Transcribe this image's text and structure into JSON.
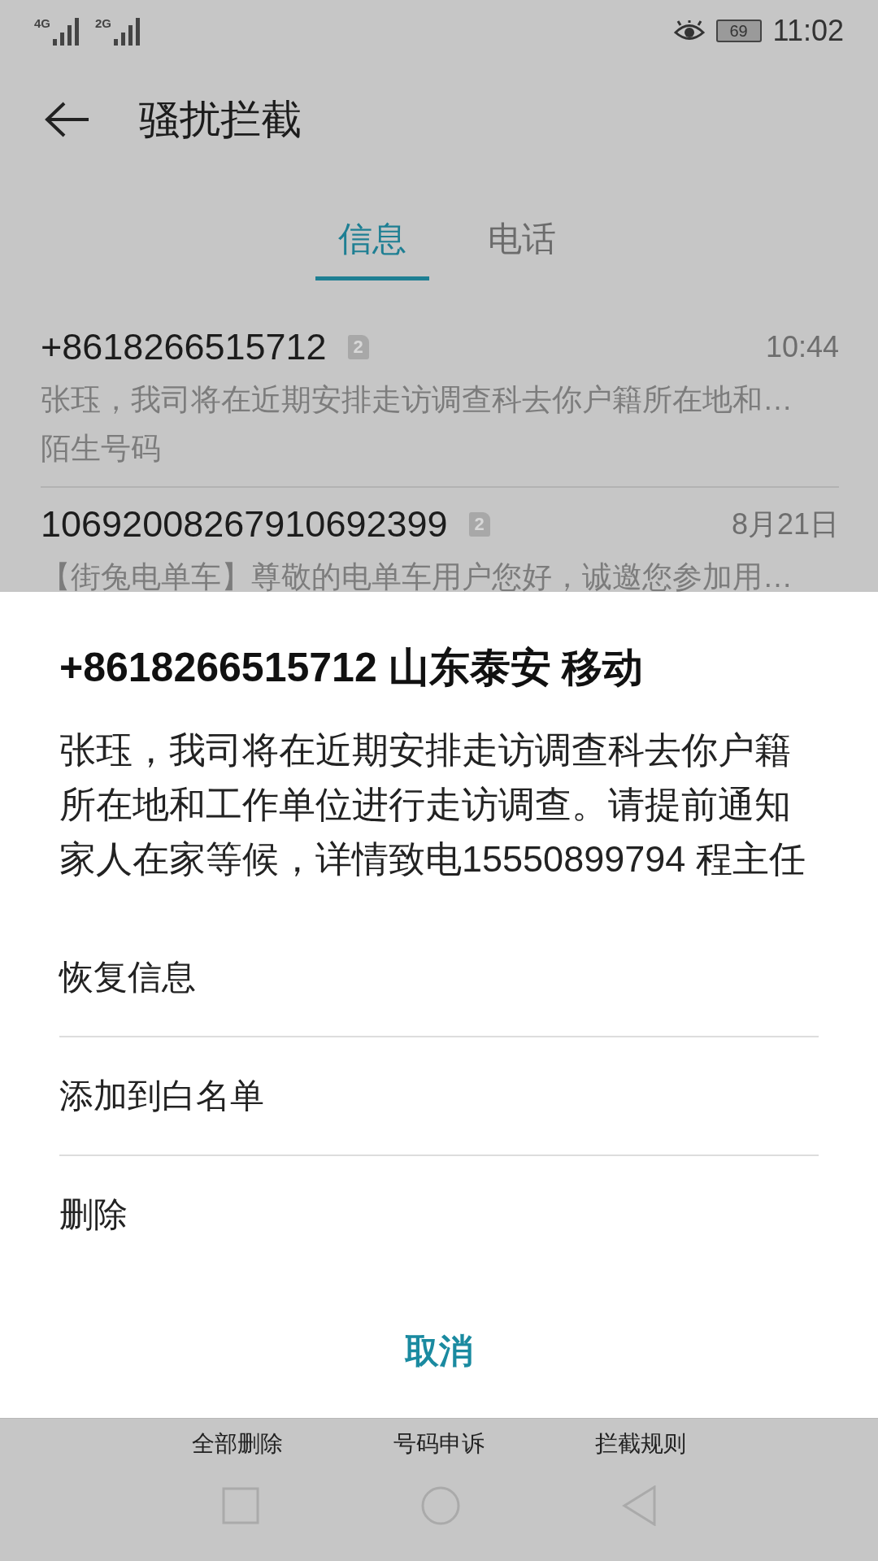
{
  "status_bar": {
    "networks": [
      "4G",
      "2G"
    ],
    "battery": "69",
    "time": "11:02"
  },
  "header": {
    "title": "骚扰拦截"
  },
  "tabs": [
    {
      "label": "信息",
      "selected": true
    },
    {
      "label": "电话",
      "selected": false
    }
  ],
  "messages": [
    {
      "sender": "+8618266515712",
      "sim": "2",
      "time": "10:44",
      "preview": "张珏，我司将在近期安排走访调查科去你户籍所在地和…",
      "tag": "陌生号码"
    },
    {
      "sender": "10692008267910692399",
      "sim": "2",
      "time": "8月21日",
      "preview": "【街兔电单车】尊敬的电单车用户您好，诚邀您参加用…"
    }
  ],
  "sheet": {
    "title": "+8618266515712 山东泰安 移动",
    "message": "张珏，我司将在近期安排走访调查科去你户籍所在地和工作单位进行走访调查。请提前通知家人在家等候，详情致电15550899794 程主任",
    "options": [
      "恢复信息",
      "添加到白名单",
      "删除"
    ],
    "cancel": "取消"
  },
  "bottom_actions": [
    "全部删除",
    "号码申诉",
    "拦截规则"
  ]
}
